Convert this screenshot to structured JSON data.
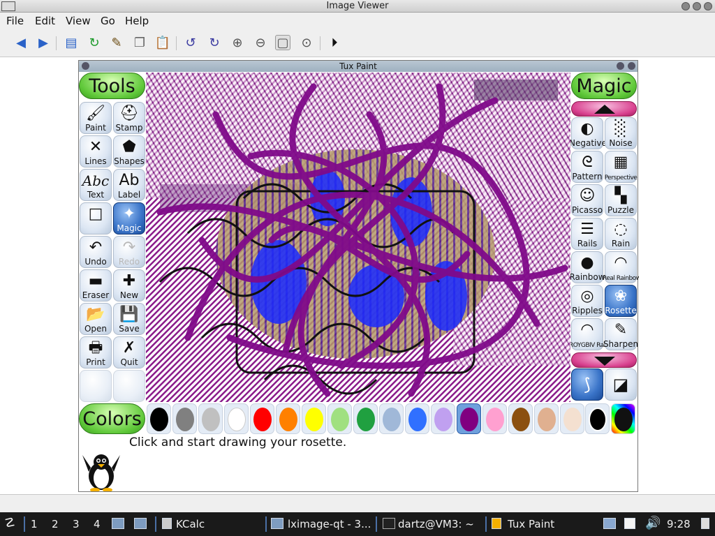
{
  "outer_window": {
    "title": "Image Viewer"
  },
  "menu": [
    "File",
    "Edit",
    "View",
    "Go",
    "Help"
  ],
  "toolbar_icons": [
    "back-arrow-icon",
    "forward-arrow-icon",
    "open-icon",
    "reload-icon",
    "edit-icon",
    "copy-icon",
    "paste-icon",
    "rotate-ccw-icon",
    "rotate-cw-icon",
    "zoom-in-icon",
    "zoom-out-icon",
    "original-size-icon",
    "zoom-fit-icon",
    "slideshow-icon"
  ],
  "tuxpaint": {
    "title": "Tux Paint",
    "tools_header": "Tools",
    "magic_header": "Magic",
    "colors_header": "Colors",
    "tools": [
      {
        "label": "Paint",
        "icon": "🖌"
      },
      {
        "label": "Stamp",
        "icon": "⛑"
      },
      {
        "label": "Lines",
        "icon": "✕"
      },
      {
        "label": "Shapes",
        "icon": "⬟"
      },
      {
        "label": "Text",
        "icon": "Abc"
      },
      {
        "label": "Label",
        "icon": "Ab"
      },
      {
        "label": "",
        "icon": "□"
      },
      {
        "label": "Magic",
        "icon": "✦"
      },
      {
        "label": "Undo",
        "icon": "↶"
      },
      {
        "label": "Redo",
        "icon": "↷"
      },
      {
        "label": "Eraser",
        "icon": "▬"
      },
      {
        "label": "New",
        "icon": "✚"
      },
      {
        "label": "Open",
        "icon": "📂"
      },
      {
        "label": "Save",
        "icon": "💾"
      },
      {
        "label": "Print",
        "icon": "🖶"
      },
      {
        "label": "Quit",
        "icon": "✗"
      }
    ],
    "magic": [
      {
        "label": "Negative",
        "icon": "◐"
      },
      {
        "label": "Noise",
        "icon": "░"
      },
      {
        "label": "Pattern",
        "icon": "ᘓ"
      },
      {
        "label": "Perspective",
        "icon": "▦"
      },
      {
        "label": "Picasso",
        "icon": "☺"
      },
      {
        "label": "Puzzle",
        "icon": "▚"
      },
      {
        "label": "Rails",
        "icon": "☰"
      },
      {
        "label": "Rain",
        "icon": "◌"
      },
      {
        "label": "Rainbow",
        "icon": "●"
      },
      {
        "label": "Real Rainbow",
        "icon": "◠"
      },
      {
        "label": "Ripples",
        "icon": "◎"
      },
      {
        "label": "Rosette",
        "icon": "❀"
      },
      {
        "label": "ROYGBIV Rainbow",
        "icon": "◠"
      },
      {
        "label": "Sharpen",
        "icon": "✎"
      }
    ],
    "instruction": "Click and start drawing your rosette.",
    "colors": [
      "#000000",
      "#808080",
      "#c0c0c0",
      "#ffffff",
      "#ff0000",
      "#ff8000",
      "#ffff00",
      "#a0e080",
      "#20a040",
      "#a0b8d8",
      "#3070ff",
      "#c0a0f0",
      "#800080",
      "#ffa0d0",
      "#8b5010",
      "#e0b090",
      "#f4e0d0"
    ]
  },
  "taskbar": {
    "desktops": [
      "1",
      "2",
      "3",
      "4"
    ],
    "tasks": [
      "KCalc",
      "lximage-qt - 3...",
      "dartz@VM3: ~",
      "Tux Paint"
    ],
    "clock": "9:28"
  }
}
